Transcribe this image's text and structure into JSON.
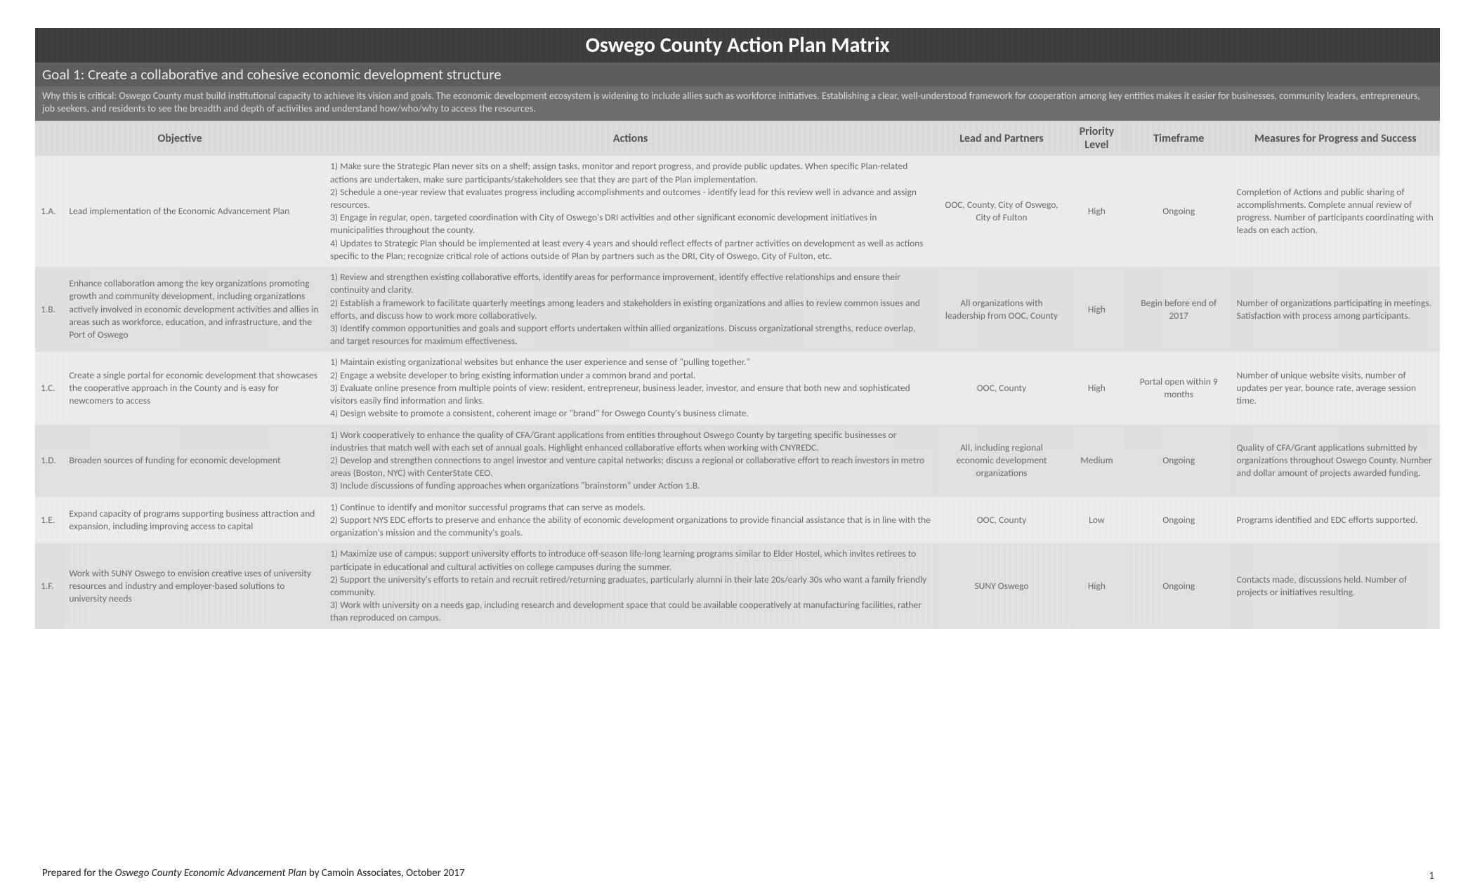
{
  "header": {
    "title": "Oswego County Action Plan Matrix",
    "goal": "Goal 1: Create a collaborative and cohesive economic development structure",
    "rationale": "Why this is critical: Oswego County must build institutional capacity to achieve its vision and goals. The economic development ecosystem is widening to include allies such as workforce initiatives. Establishing a clear, well-understood framework for cooperation among key entities makes it easier for businesses, community leaders, entrepreneurs, job seekers, and residents to see the breadth and depth of activities and understand how/who/why to access the resources."
  },
  "columns": {
    "objective": "Objective",
    "actions": "Actions",
    "lead": "Lead and Partners",
    "priority": "Priority Level",
    "timeframe": "Timeframe",
    "measures": "Measures for Progress and Success"
  },
  "rows": [
    {
      "id": "1.A.",
      "objective": "Lead implementation of the Economic Advancement Plan",
      "actions": "1) Make sure the Strategic Plan never sits on a shelf; assign tasks, monitor and report progress, and provide public updates. When specific Plan-related actions are undertaken, make sure participants/stakeholders see that they are part of the Plan implementation.\n2) Schedule a one-year review that evaluates progress including accomplishments and outcomes - identify lead for this review well in advance and assign resources.\n3) Engage in regular, open, targeted coordination with City of Oswego's DRI activities and other significant economic development initiatives in municipalities throughout the county.\n4) Updates to Strategic Plan should be implemented at least every 4 years and should reflect effects of partner activities on development as well as actions specific to the Plan; recognize critical role of actions outside of Plan by partners such as the DRI, City of Oswego, City of Fulton, etc.",
      "lead": "OOC, County, City of Oswego, City of Fulton",
      "priority": "High",
      "timeframe": "Ongoing",
      "measures": "Completion of Actions and public sharing of accomplishments. Complete annual review of progress. Number of participants coordinating with leads on each action."
    },
    {
      "id": "1.B.",
      "objective": "Enhance collaboration among the key organizations promoting growth and community development, including organizations actively involved in economic development activities and allies in areas such as workforce, education, and infrastructure, and the Port of Oswego",
      "actions": "1) Review and strengthen existing collaborative efforts, identify areas for performance improvement, identify effective relationships and ensure their continuity and clarity.\n2) Establish a framework to facilitate quarterly meetings among leaders and stakeholders in existing organizations and allies to review common issues and efforts, and discuss how to work more collaboratively.\n3) Identify common opportunities and goals and support efforts undertaken within allied organizations. Discuss organizational strengths, reduce overlap, and target resources for maximum effectiveness.",
      "lead": "All organizations with leadership from OOC, County",
      "priority": "High",
      "timeframe": "Begin before end of 2017",
      "measures": "Number of organizations participating in meetings. Satisfaction with process among participants."
    },
    {
      "id": "1.C.",
      "objective": "Create a single portal for economic development that showcases the cooperative approach in the County and is easy for newcomers to access",
      "actions": "1) Maintain existing organizational websites but enhance the user experience and sense of \"pulling together.\"\n2) Engage a website developer to bring existing information under a common brand and portal.\n3) Evaluate online presence from multiple points of view: resident, entrepreneur, business leader, investor, and ensure that both new and sophisticated visitors easily find information and links.\n4) Design website to promote a consistent, coherent image or \"brand\" for Oswego County's business climate.",
      "lead": "OOC, County",
      "priority": "High",
      "timeframe": "Portal open within 9 months",
      "measures": "Number of unique website visits, number of updates per year, bounce rate, average session time."
    },
    {
      "id": "1.D.",
      "objective": "Broaden sources of funding for economic development",
      "actions": "1) Work cooperatively to enhance the quality of CFA/Grant applications from entities throughout Oswego County by targeting specific businesses or industries that match well with each set of annual goals. Highlight enhanced collaborative efforts when working with CNYREDC.\n2) Develop and strengthen connections to angel investor and venture capital networks; discuss a regional or collaborative effort to reach investors in metro areas (Boston, NYC) with CenterState CEO.\n3) Include discussions of funding approaches when organizations \"brainstorm\" under Action 1.B.",
      "lead": "All, including regional economic development organizations",
      "priority": "Medium",
      "timeframe": "Ongoing",
      "measures": "Quality of CFA/Grant applications submitted by organizations throughout Oswego County. Number and dollar amount of projects awarded funding."
    },
    {
      "id": "1.E.",
      "objective": "Expand capacity of programs supporting business attraction and expansion, including improving access to capital",
      "actions": "1) Continue to identify and monitor successful programs that can serve as models.\n2) Support NYS EDC efforts to preserve and enhance the ability of economic development organizations to provide financial assistance that is in line with the organization's mission and the community's goals.",
      "lead": "OOC, County",
      "priority": "Low",
      "timeframe": "Ongoing",
      "measures": "Programs identified and EDC efforts supported."
    },
    {
      "id": "1.F.",
      "objective": "Work with SUNY Oswego to envision creative uses of university resources and industry and employer-based solutions to university needs",
      "actions": "1) Maximize use of campus; support university efforts to introduce off-season life-long learning programs similar to Elder Hostel, which invites retirees to participate in educational and cultural activities on college campuses during the summer.\n2) Support the university's efforts to retain and recruit retired/returning graduates, particularly alumni in their late 20s/early 30s who want a family friendly community.\n3) Work with university on a needs gap, including research and development space that could be available cooperatively at manufacturing facilities, rather than reproduced on campus.",
      "lead": "SUNY Oswego",
      "priority": "High",
      "timeframe": "Ongoing",
      "measures": "Contacts made, discussions held. Number of projects or initiatives resulting."
    }
  ],
  "footer": {
    "prefix": "Prepared for the ",
    "plan_name": "Oswego County Economic Advancement Plan",
    "suffix": " by Camoin Associates, October 2017",
    "page": "1"
  }
}
